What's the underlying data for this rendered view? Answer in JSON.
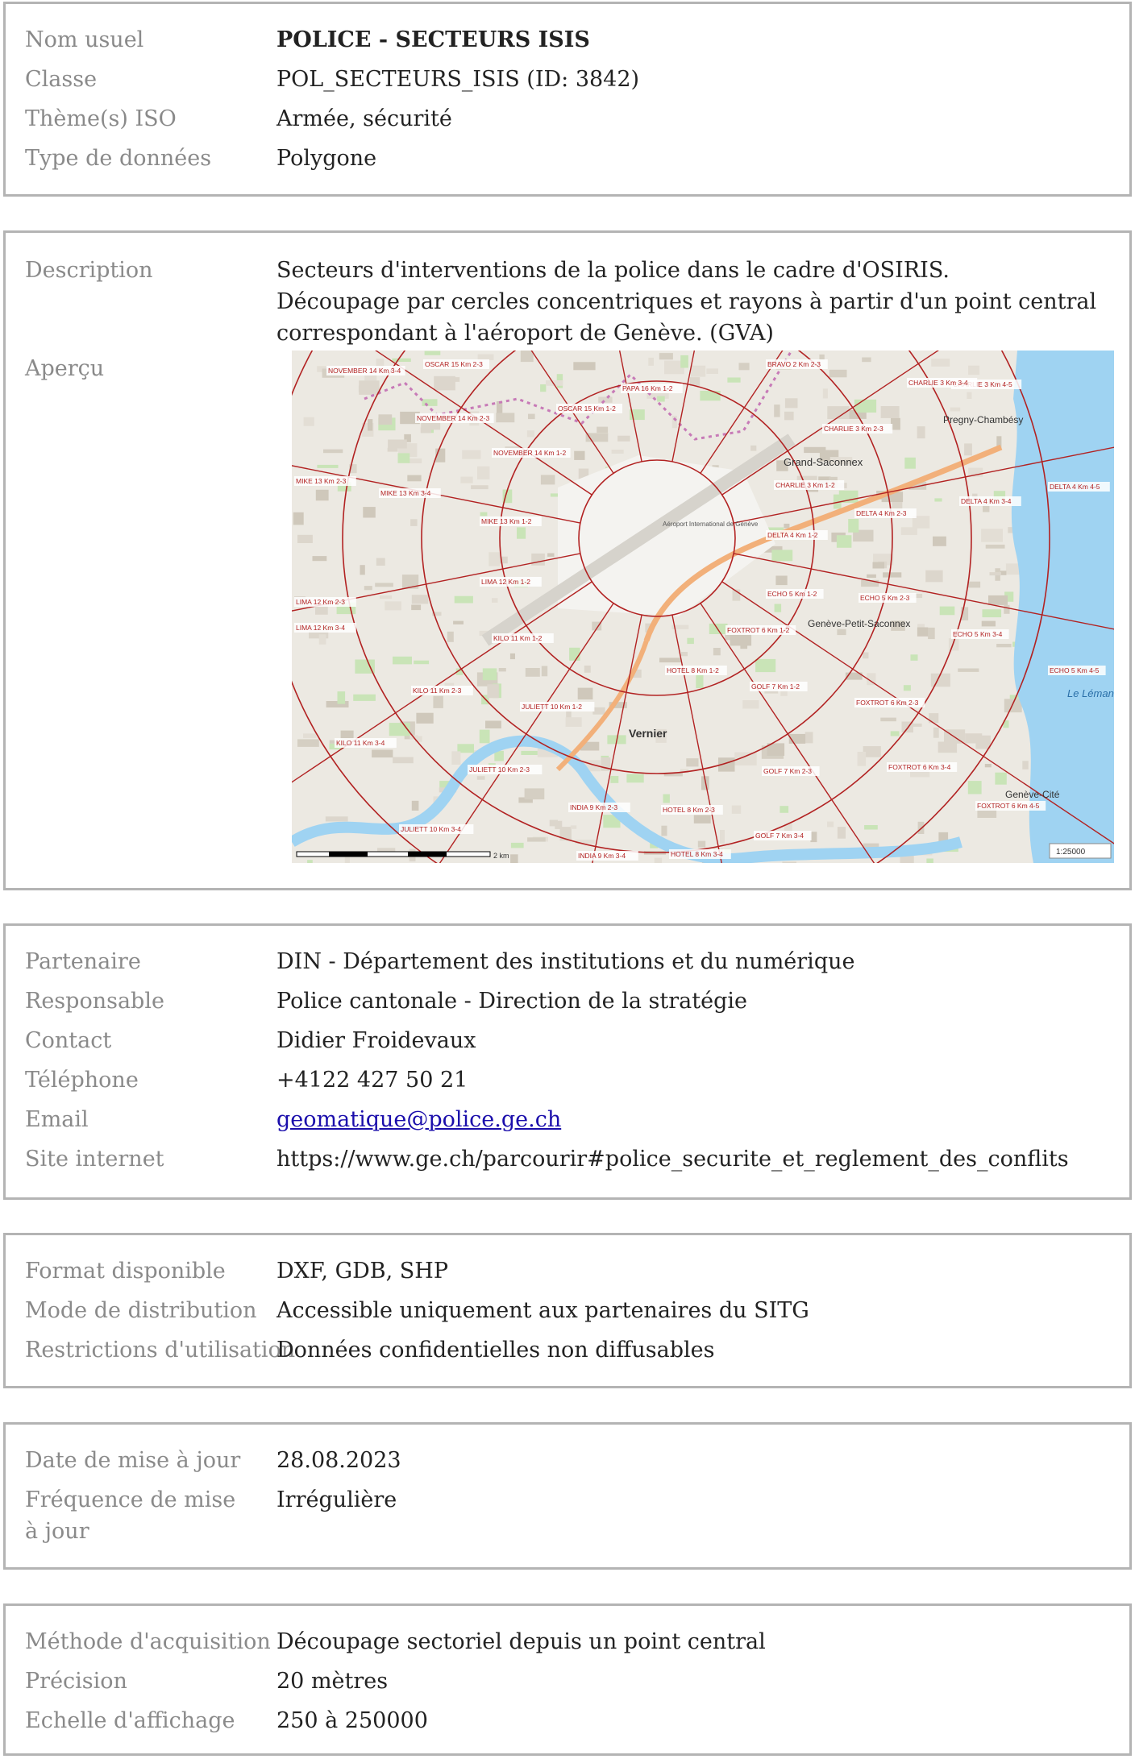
{
  "identity": {
    "rows": [
      {
        "label": "Nom usuel",
        "value": "POLICE - SECTEURS ISIS"
      },
      {
        "label": "Classe",
        "value": "POL_SECTEURS_ISIS (ID: 3842)"
      },
      {
        "label": "Thème(s) ISO",
        "value": "Armée, sécurité"
      },
      {
        "label": "Type de données",
        "value": "Polygone"
      }
    ]
  },
  "description": {
    "label": "Description",
    "lines": [
      "Secteurs d'interventions de la police dans le cadre d'OSIRIS.",
      "Découpage par cercles concentriques et rayons à partir d'un point central",
      "correspondant à l'aéroport de Genève. (GVA)"
    ],
    "preview_label": "Aperçu"
  },
  "map": {
    "places": [
      "Grand-Saconnex",
      "Pregny-Chambésy",
      "Genève-Petit-Saconnex",
      "Vernier",
      "Genève-Cité",
      "Aéroport International de Genève",
      "Le Léman"
    ],
    "sector_labels": [
      "NOVEMBER 14 Km 3-4",
      "OSCAR 15 Km 2-3",
      "BRAVO 2 Km 2-3",
      "CHARLIE 3 Km 4-5",
      "CHARLIE 3 Km 3-4",
      "NOVEMBER 14 Km 2-3",
      "PAPA 16 Km 1-2",
      "CHARLIE 3 Km 2-3",
      "OSCAR 15 Km 1-2",
      "NOVEMBER 14 Km 1-2",
      "CHARLIE 3 Km 1-2",
      "DELTA 4 Km 4-5",
      "MIKE 13 Km 3-4",
      "MIKE 13 Km 2-3",
      "MIKE 13 Km 1-2",
      "DELTA 4 Km 3-4",
      "DELTA 4 Km 2-3",
      "DELTA 4 Km 1-2",
      "LIMA 12 Km 1-2",
      "LIMA 12 Km 2-3",
      "ECHO 5 Km 1-2",
      "ECHO 5 Km 2-3",
      "LIMA 12 Km 3-4",
      "KILO 11 Km 1-2",
      "FOXTROT 6 Km 1-2",
      "ECHO 5 Km 3-4",
      "KILO 11 Km 2-3",
      "ECHO 5 Km 4-5",
      "JULIETT 10 Km 1-2",
      "HOTEL 8 Km 1-2",
      "GOLF 7 Km 1-2",
      "FOXTROT 6 Km 2-3",
      "KILO 11 Km 3-4",
      "JULIETT 10 Km 2-3",
      "GOLF 7 Km 2-3",
      "FOXTROT 6 Km 3-4",
      "INDIA 9 Km 2-3",
      "HOTEL 8 Km 2-3",
      "FOXTROT 6 Km 4-5",
      "JULIETT 10 Km 3-4",
      "GOLF 7 Km 3-4",
      "INDIA 9 Km 3-4",
      "HOTEL 8 Km 3-4"
    ],
    "scale_text": "1:25000",
    "scale_bar": "2 km"
  },
  "contact": {
    "rows": [
      {
        "label": "Partenaire",
        "value": "DIN - Département des institutions et du numérique"
      },
      {
        "label": "Responsable",
        "value": "Police cantonale - Direction de la stratégie"
      },
      {
        "label": "Contact",
        "value": "Didier Froidevaux"
      },
      {
        "label": "Téléphone",
        "value": "+4122 427 50 21"
      },
      {
        "label": "Email",
        "value": "geomatique@police.ge.ch"
      },
      {
        "label": "Site internet",
        "value": "https://www.ge.ch/parcourir#police_securite_et_reglement_des_conflits"
      }
    ]
  },
  "distribution": {
    "rows": [
      {
        "label": "Format disponible",
        "value": "DXF, GDB, SHP"
      },
      {
        "label": "Mode de distribution",
        "value": "Accessible uniquement aux partenaires du SITG"
      },
      {
        "label": "Restrictions d'utilisation",
        "value": "Données confidentielles non diffusables"
      }
    ]
  },
  "update": {
    "rows": [
      {
        "label": "Date de mise à jour",
        "value": "28.08.2023"
      },
      {
        "label": "Fréquence de mise à jour",
        "value": "Irrégulière"
      }
    ]
  },
  "acquisition": {
    "rows": [
      {
        "label": "Méthode d'acquisition",
        "value": "Découpage sectoriel depuis un point central"
      },
      {
        "label": "Précision",
        "value": "20 mètres"
      },
      {
        "label": "Echelle d'affichage",
        "value": "250 à 250000"
      }
    ]
  },
  "colors": {
    "border": "#b4b4b4",
    "label": "#8a8a8a",
    "link": "#1a0dab",
    "sector_lines": "#b22222",
    "lake": "#9fd3f2"
  }
}
